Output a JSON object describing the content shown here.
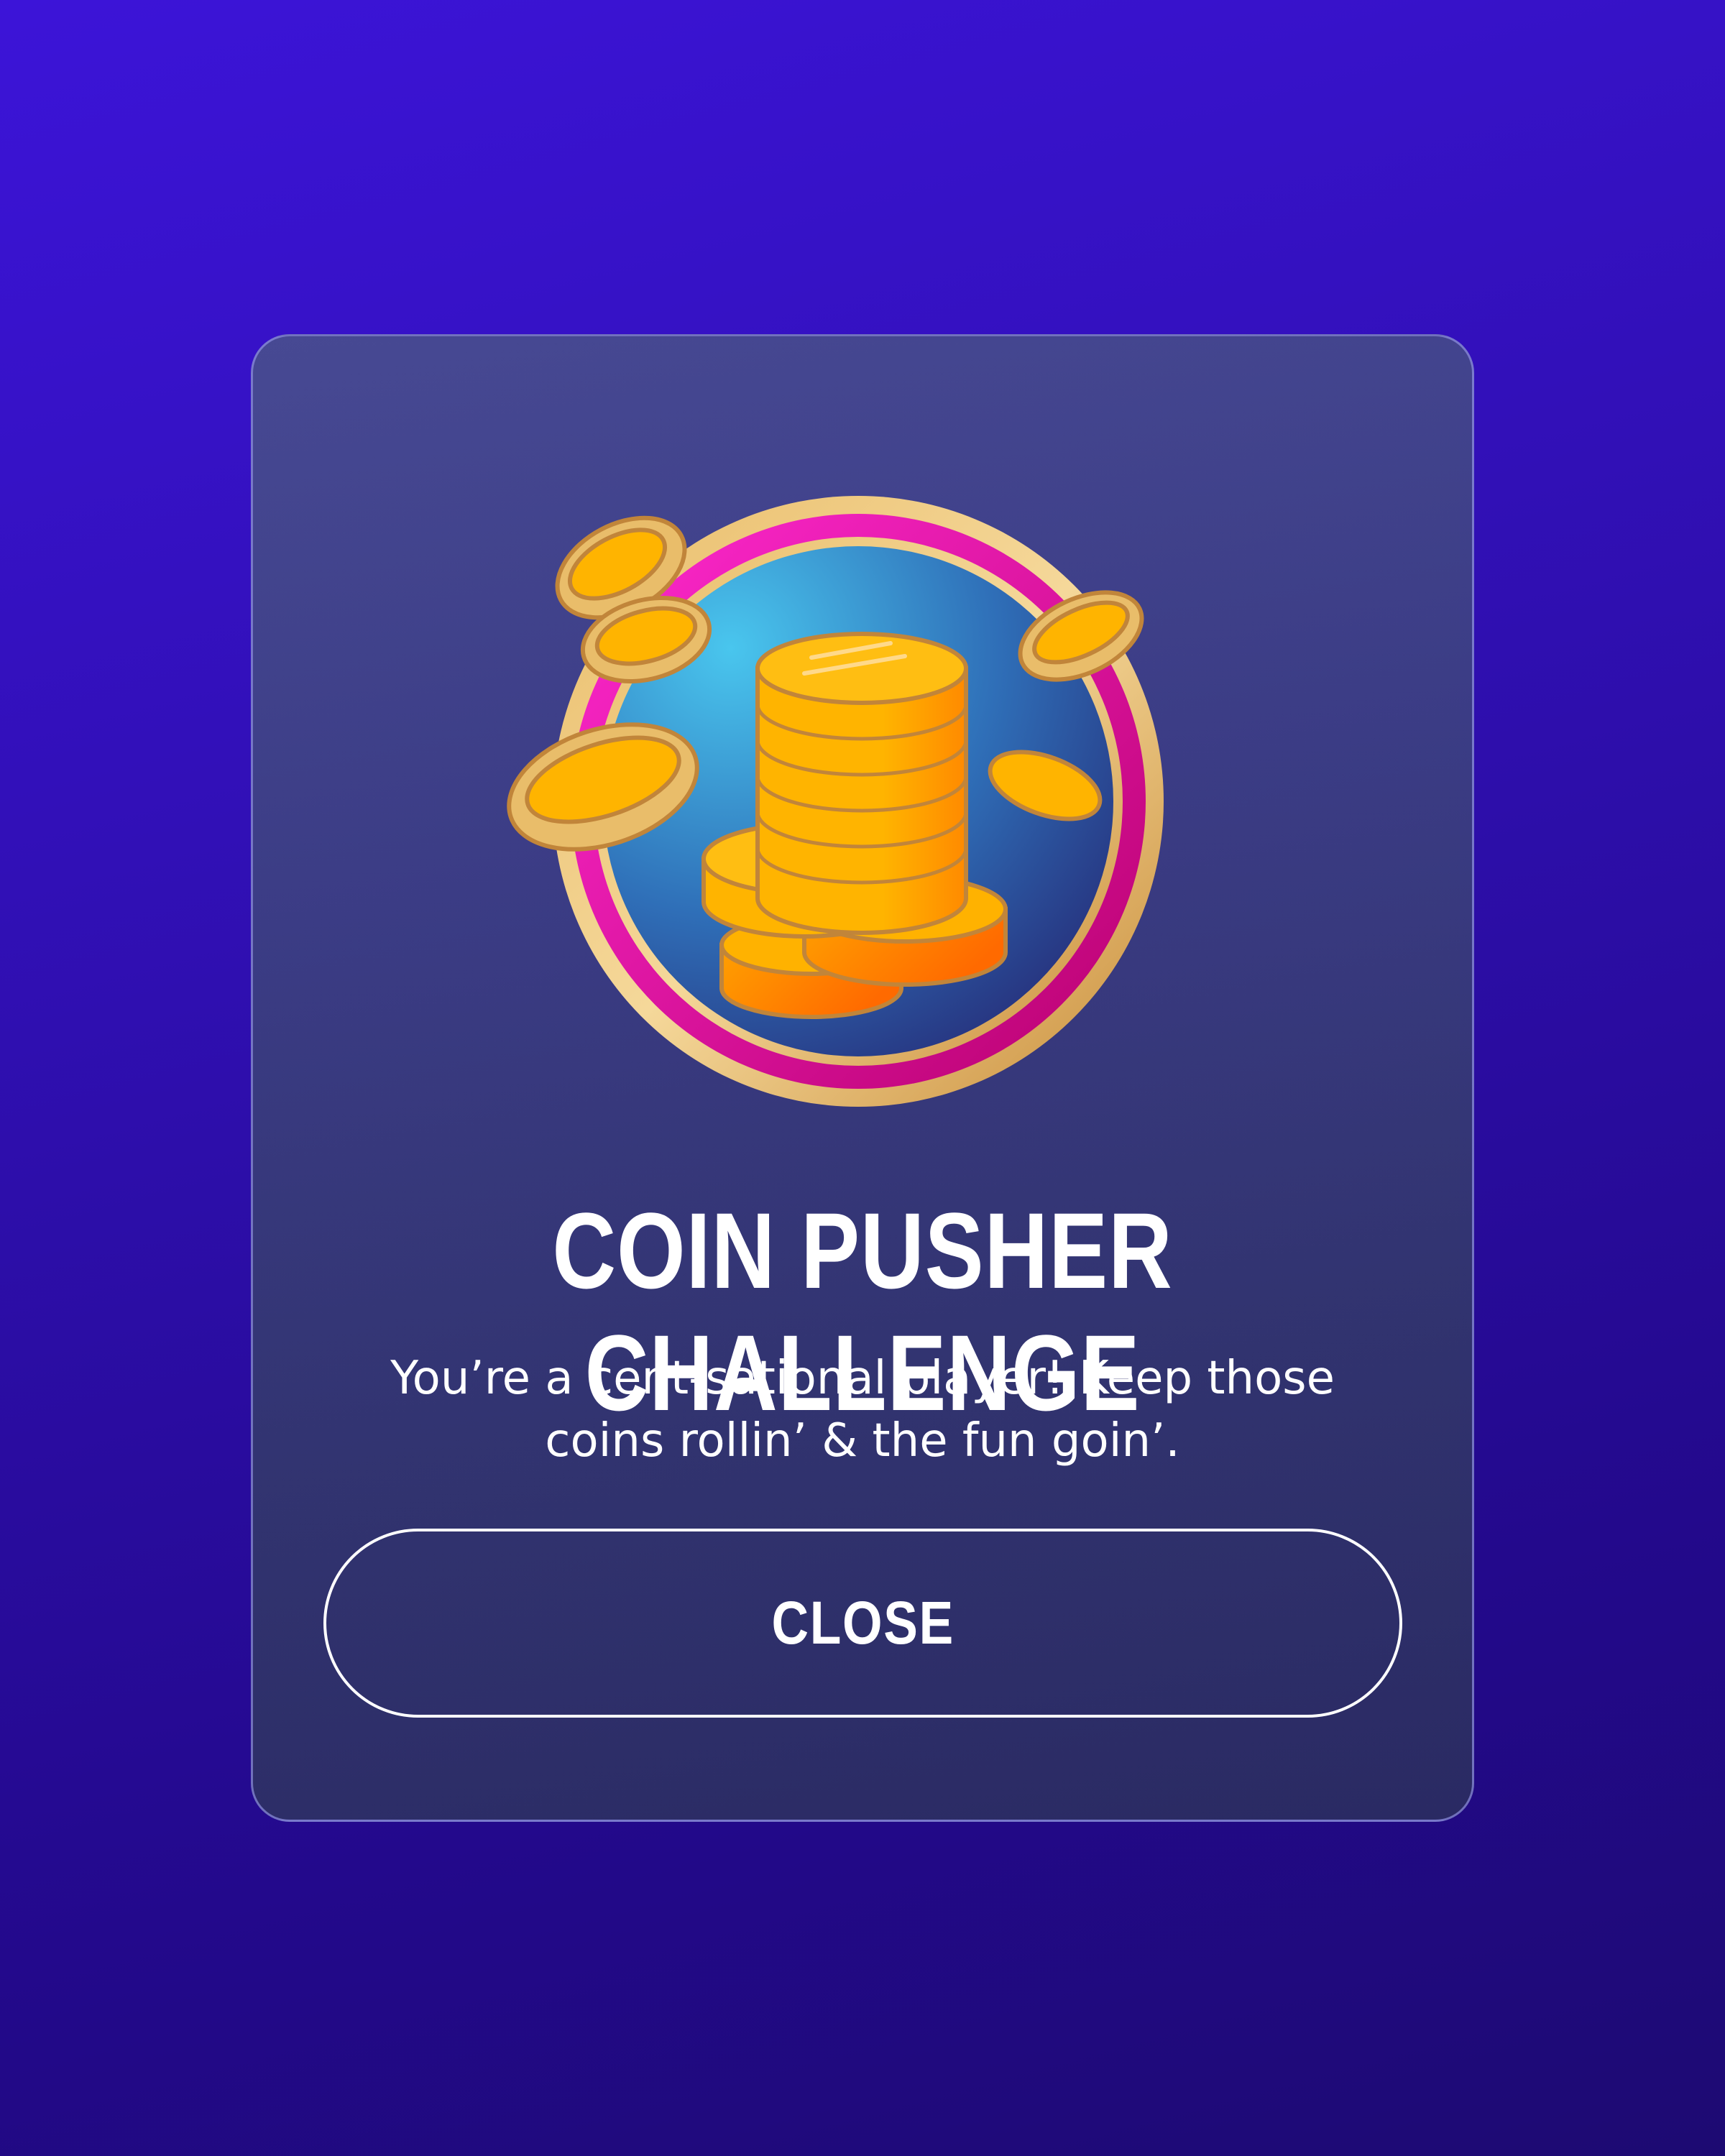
{
  "dialog": {
    "title": "COIN PUSHER CHALLENGE",
    "message": "You’re a cent-sational player! Keep those coins rollin’ & the fun goin’.",
    "close_label": "CLOSE",
    "badge_icon": "coin-stack-badge-icon"
  },
  "colors": {
    "background": "#3312c4",
    "card": "#3b3c85",
    "coin": "#ffb800",
    "coin_shadow": "#ff7a00",
    "ring": "#e80fb4",
    "badge_bg": "#3aa0dc"
  }
}
